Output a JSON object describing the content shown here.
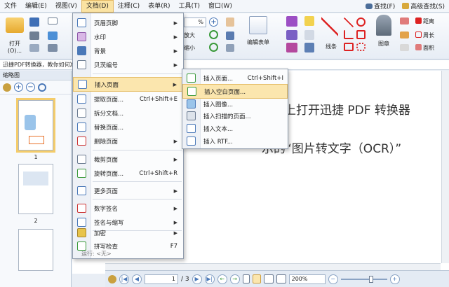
{
  "menubar": {
    "items": [
      "文件",
      "编辑(E)",
      "视图(V)",
      "文档(D)",
      "注释(C)",
      "表单(R)",
      "工具(T)",
      "窗口(W)"
    ],
    "find": "查找(F)",
    "advanced_find": "高级查找(S)"
  },
  "ribbon": {
    "open": "打开(O)...",
    "zoom_in": "放大",
    "zoom_out": "缩小",
    "edit_form": "编辑表单",
    "lines": "线条",
    "stamp": "图章",
    "distance": "距离",
    "perimeter": "周长",
    "area": "面积",
    "zoom_value": "%"
  },
  "infobar": {
    "text": "迅捷PDF转换器，教你如何准"
  },
  "thumbpanel": {
    "title": "缩略图",
    "page1": "1",
    "page2": "2"
  },
  "document": {
    "line1": "电脑上打开迅捷 PDF 转换器",
    "line2": "示的“图片转文字（OCR）”"
  },
  "statusbar": {
    "page_value": "1",
    "page_total": "/ 3",
    "zoom": "200%"
  },
  "doc_menu": {
    "items": [
      {
        "label": "页眉页脚",
        "arrow": true
      },
      {
        "label": "水印",
        "arrow": true
      },
      {
        "label": "背景",
        "arrow": true
      },
      {
        "label": "贝茨编号",
        "arrow": true
      },
      {
        "label": "插入页面",
        "arrow": true,
        "highlight": true
      },
      {
        "label": "提取页面...",
        "shortcut": "Ctrl+Shift+E"
      },
      {
        "label": "拆分文档..."
      },
      {
        "label": "替换页面..."
      },
      {
        "label": "删除页面",
        "arrow": true
      },
      {
        "label": "裁剪页面",
        "arrow": true
      },
      {
        "label": "旋转页面...",
        "shortcut": "Ctrl+Shift+R"
      },
      {
        "label": "更多页面",
        "arrow": true
      },
      {
        "label": "数字签名",
        "arrow": true
      },
      {
        "label": "签名与缩写",
        "arrow": true
      },
      {
        "label": "加密",
        "arrow": true
      },
      {
        "label": "拼写检查",
        "shortcut": "F7"
      },
      {
        "label": "运行: <无>"
      }
    ]
  },
  "insert_menu": {
    "items": [
      {
        "label": "插入页面...",
        "shortcut": "Ctrl+Shift+I"
      },
      {
        "label": "插入空白页面...",
        "highlight": true
      },
      {
        "label": "插入图像..."
      },
      {
        "label": "插入扫描的页面..."
      },
      {
        "label": "插入文本..."
      },
      {
        "label": "插入 RTF..."
      }
    ]
  },
  "colors": {
    "highlight": "#fbe6ae",
    "accent": "#2d5fa8"
  }
}
